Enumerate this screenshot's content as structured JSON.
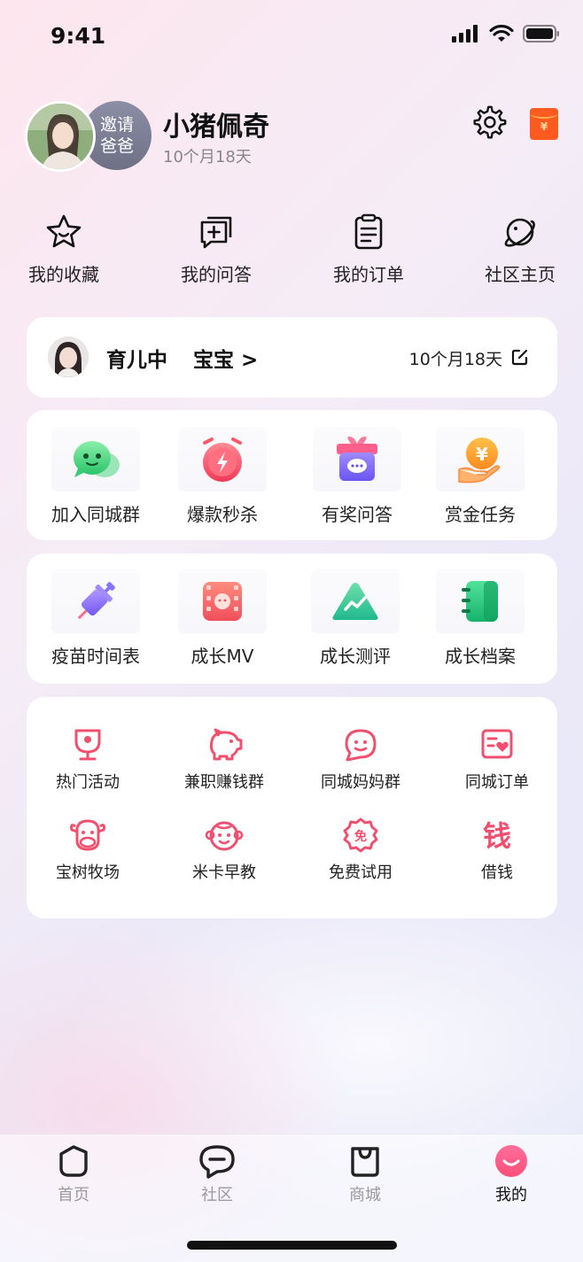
{
  "status_bar": {
    "time": "9:41"
  },
  "header": {
    "user_name": "小猪佩奇",
    "child_age": "10个月18天",
    "invite_label_1": "邀请",
    "invite_label_2": "爸爸",
    "redpacket_symbol": "¥"
  },
  "quick_links": [
    {
      "label": "我的收藏",
      "icon": "star-icon"
    },
    {
      "label": "我的问答",
      "icon": "qa-icon"
    },
    {
      "label": "我的订单",
      "icon": "order-icon"
    },
    {
      "label": "社区主页",
      "icon": "planet-icon"
    }
  ],
  "baby_card": {
    "status": "育儿中",
    "name": "宝宝 >",
    "age": "10个月18天"
  },
  "services": [
    {
      "label": "加入同城群",
      "icon": "wechat-group-icon",
      "color": "#3ed27a"
    },
    {
      "label": "爆款秒杀",
      "icon": "flash-sale-icon",
      "color": "#ff4f62"
    },
    {
      "label": "有奖问答",
      "icon": "gift-qa-icon",
      "color": "#7b6cff"
    },
    {
      "label": "赏金任务",
      "icon": "reward-coin-icon",
      "color": "#ff9a1f"
    }
  ],
  "growth": [
    {
      "label": "疫苗时间表",
      "icon": "vaccine-icon",
      "color": "#7b6cff"
    },
    {
      "label": "成长MV",
      "icon": "mv-film-icon",
      "color": "#ff5a5f"
    },
    {
      "label": "成长测评",
      "icon": "mountain-chart-icon",
      "color": "#2dc59a"
    },
    {
      "label": "成长档案",
      "icon": "archive-book-icon",
      "color": "#2ec77b"
    }
  ],
  "tools": [
    {
      "label": "热门活动",
      "icon": "trophy-icon"
    },
    {
      "label": "兼职赚钱群",
      "icon": "piggy-bank-icon"
    },
    {
      "label": "同城妈妈群",
      "icon": "chat-face-icon"
    },
    {
      "label": "同城订单",
      "icon": "order-heart-icon"
    },
    {
      "label": "宝树牧场",
      "icon": "cow-icon"
    },
    {
      "label": "米卡早教",
      "icon": "monkey-icon"
    },
    {
      "label": "免费试用",
      "icon": "free-badge-icon",
      "glyph": "免"
    },
    {
      "label": "借钱",
      "icon": "loan-icon",
      "glyph": "钱"
    }
  ],
  "tab_bar": [
    {
      "label": "首页",
      "icon": "home-icon",
      "active": false
    },
    {
      "label": "社区",
      "icon": "community-icon",
      "active": false
    },
    {
      "label": "商城",
      "icon": "shop-bag-icon",
      "active": false
    },
    {
      "label": "我的",
      "icon": "profile-icon",
      "active": true
    }
  ],
  "colors": {
    "accent": "#ff4f7a",
    "tool_icon": "#f0506e"
  }
}
